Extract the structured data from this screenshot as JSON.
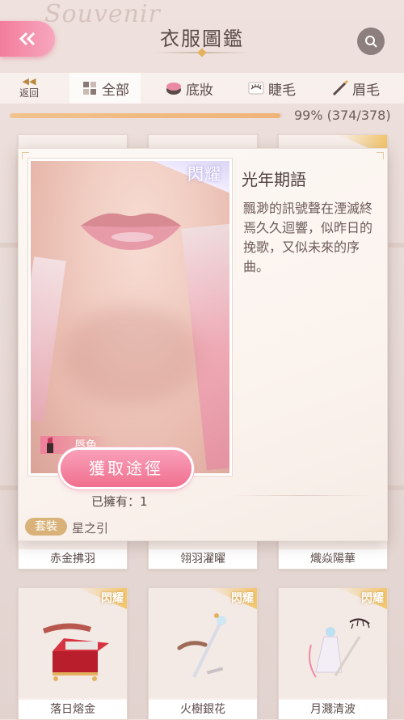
{
  "header": {
    "title": "衣服圖鑑",
    "bg_sign": "Souvenir"
  },
  "tabs": {
    "back_label": "返回",
    "back_arrow": "◀◀",
    "items": [
      {
        "label": "全部",
        "icon": "grid-icon",
        "active": true
      },
      {
        "label": "底妝",
        "icon": "compact-icon",
        "active": false
      },
      {
        "label": "睫毛",
        "icon": "eyelash-icon",
        "active": false
      },
      {
        "label": "眉毛",
        "icon": "eyebrow-pencil-icon",
        "active": false
      }
    ]
  },
  "progress": {
    "fraction": 0.99,
    "text": "99% (374/378)"
  },
  "grid": {
    "flash_label": "閃耀",
    "row1": [
      "赤金拂羽",
      "翎羽濯曜",
      "熾焱陽華"
    ],
    "row2": [
      "落日熔金",
      "火樹銀花",
      "月濺清波"
    ]
  },
  "detail": {
    "badge": "閃耀",
    "category_tag": "唇色",
    "item_name": "光年期語",
    "description": "飄渺的訊號聲在湮滅終焉久久迴響，似昨日的挽歌，又似未來的序曲。",
    "acquire_button": "獲取途徑",
    "owned_text": "已擁有：1",
    "set_badge": "套裝",
    "set_name": "星之引"
  },
  "colors": {
    "accent_pink": "#f0708f",
    "gold": "#d9b27a",
    "progress": "#f0b377"
  }
}
